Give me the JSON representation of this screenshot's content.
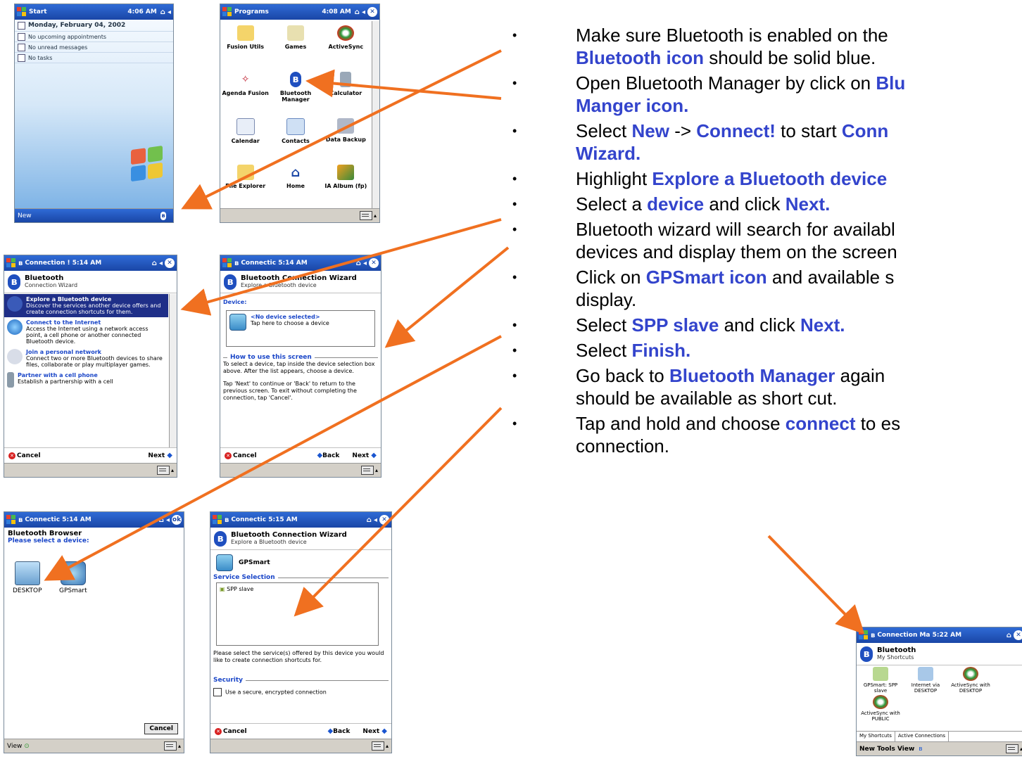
{
  "screens": {
    "today": {
      "title": "Start",
      "time": "4:06 AM",
      "rows": [
        "Monday, February 04, 2002",
        "No upcoming appointments",
        "No unread messages",
        "No tasks"
      ],
      "softkey": "New"
    },
    "programs": {
      "title": "Programs",
      "time": "4:08 AM",
      "apps": [
        {
          "label": "Fusion Utils",
          "icon": "folder-icon"
        },
        {
          "label": "Games",
          "icon": "games-folder-icon"
        },
        {
          "label": "ActiveSync",
          "icon": "activesync-icon"
        },
        {
          "label": "Agenda Fusion",
          "icon": "agenda-fusion-icon"
        },
        {
          "label": "Bluetooth Manager",
          "icon": "bluetooth-icon"
        },
        {
          "label": "Calculator",
          "icon": "calculator-icon"
        },
        {
          "label": "Calendar",
          "icon": "calendar-icon"
        },
        {
          "label": "Contacts",
          "icon": "contacts-icon"
        },
        {
          "label": "Data Backup",
          "icon": "backup-icon"
        },
        {
          "label": "File Explorer",
          "icon": "file-explorer-icon"
        },
        {
          "label": "Home",
          "icon": "home-icon"
        },
        {
          "label": "IA Album (fp)",
          "icon": "album-icon"
        }
      ]
    },
    "wizard": {
      "title": "Connection ! 5:14 AM",
      "header_title": "Bluetooth",
      "header_sub": "Connection Wizard",
      "items": [
        {
          "title": "Explore a Bluetooth device",
          "desc": "Discover the services another device offers and create connection shortcuts for them."
        },
        {
          "title": "Connect to the Internet",
          "desc": "Access the Internet using a network access point, a cell phone or another connected Bluetooth device."
        },
        {
          "title": "Join a personal network",
          "desc": "Connect two or more Bluetooth devices to share files, collaborate or play multiplayer games."
        },
        {
          "title": "Partner with a cell phone",
          "desc": "Establish a partnership with a cell"
        }
      ],
      "cancel": "Cancel",
      "next": "Next"
    },
    "device": {
      "title": "Connectic 5:14 AM",
      "header_title": "Bluetooth Connection Wizard",
      "header_sub": "Explore a Bluetooth device",
      "device_label": "Device:",
      "no_device": "<No device selected>",
      "tap_here": "Tap here to choose a device",
      "how_head": "How to use this screen",
      "how_text": "To select a device, tap inside the device selection box above. After the list appears, choose a device.",
      "tap_next": "Tap 'Next' to continue or 'Back' to return to the previous screen. To exit without completing the connection, tap 'Cancel'.",
      "cancel": "Cancel",
      "back": "Back",
      "next": "Next"
    },
    "browser": {
      "title": "Connectic 5:14 AM",
      "header_title": "Bluetooth Browser",
      "header_sub": "Please select a device:",
      "devices": [
        "DESKTOP",
        "GPSmart"
      ],
      "cancel": "Cancel",
      "view": "View"
    },
    "service": {
      "title": "Connectic 5:15 AM",
      "header_title": "Bluetooth Connection Wizard",
      "header_sub": "Explore a Bluetooth device",
      "device_name": "GPSmart",
      "svc_head": "Service Selection",
      "svc_item": "SPP slave",
      "svc_text": "Please select the service(s) offered by this device you would like to create connection shortcuts for.",
      "sec_head": "Security",
      "sec_option": "Use a secure, encrypted connection",
      "cancel": "Cancel",
      "back": "Back",
      "next": "Next"
    },
    "shortcuts": {
      "title": "Connection Ma 5:22 AM",
      "header_title": "Bluetooth",
      "header_sub": "My Shortcuts",
      "items": [
        "GPSmart: SPP slave",
        "Internet via DESKTOP",
        "ActiveSync with DESKTOP",
        "ActiveSync with PUBLIC"
      ],
      "tabs": [
        "My Shortcuts",
        "Active Connections"
      ],
      "menu": "New Tools View"
    }
  },
  "steps": {
    "s1a": "Make sure Bluetooth is enabled on the",
    "s1b": "Bluetooth icon",
    "s1c": " should be solid blue.",
    "s2a": "Open Bluetooth Manager by click on ",
    "s2b": "Blu",
    "s2c": "Manger icon.",
    "s3a": "Select ",
    "s3b": "New",
    "s3c": " -> ",
    "s3d": "Connect!",
    "s3e": " to start ",
    "s3f": "Conn",
    "s3g": "Wizard.",
    "s4a": "Highlight ",
    "s4b": "Explore a Bluetooth device",
    "s5a": "Select a ",
    "s5b": "device",
    "s5c": " and click ",
    "s5d": "Next.",
    "s6a": "Bluetooth wizard will search for availabl",
    "s6b": "devices and display them on the screen",
    "s7a": "Click on ",
    "s7b": "GPSmart icon",
    "s7c": " and available s",
    "s7d": "display.",
    "s8a": "Select ",
    "s8b": "SPP slave",
    "s8c": " and click ",
    "s8d": "Next.",
    "s9a": "Select ",
    "s9b": "Finish.",
    "s10a": "Go back to ",
    "s10b": "Bluetooth Manager",
    "s10c": " again",
    "s10d": "should be available as short cut.",
    "s11a": "Tap and hold and choose ",
    "s11b": "connect",
    "s11c": " to es",
    "s11d": "connection."
  },
  "colors": {
    "arrow": "#f07020",
    "highlight": "#3344cc",
    "titlebar": "#1a46a6"
  }
}
